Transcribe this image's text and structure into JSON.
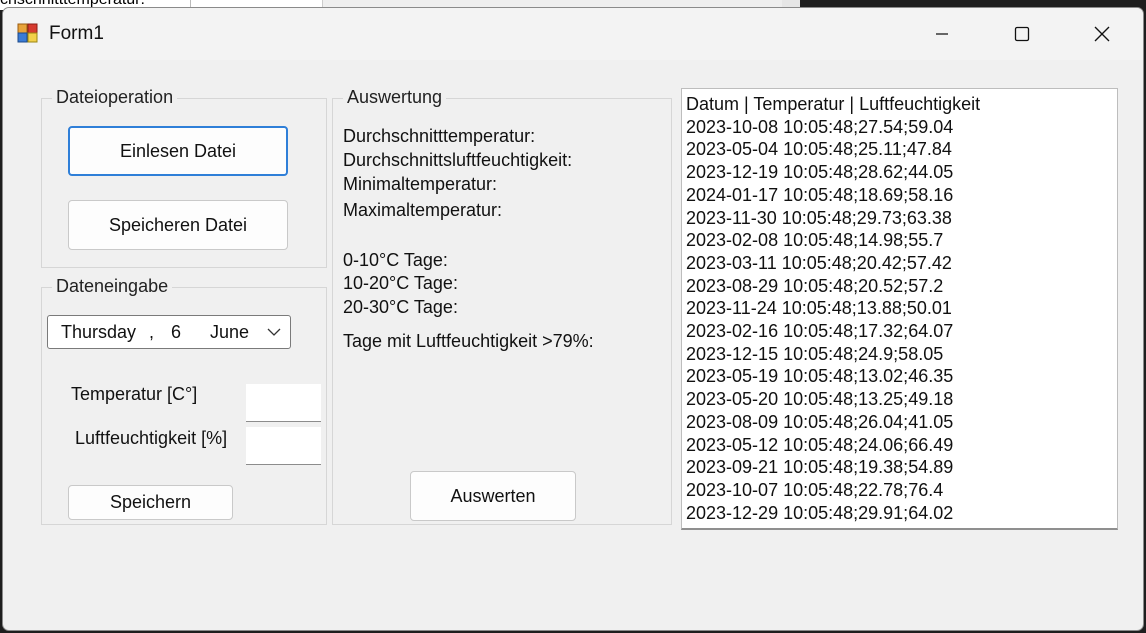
{
  "background_app": {
    "fragment_text": "chschnitttemperatur:"
  },
  "window": {
    "title": "Form1",
    "icon": "winforms-app-icon"
  },
  "titlebar_buttons": {
    "minimize": "minimize-icon",
    "maximize": "maximize-icon",
    "close": "close-icon"
  },
  "dateioperation": {
    "legend": "Dateioperation",
    "load_label": "Einlesen Datei",
    "save_label": "Speicheren Datei"
  },
  "dateneingabe": {
    "legend": "Dateneingabe",
    "date": {
      "weekday": "Thursday",
      "sep": ",",
      "day": "6",
      "month": "June"
    },
    "temperature_label": "Temperatur [C°]",
    "temperature_value": "",
    "humidity_label": "Luftfeuchtigkeit [%]",
    "humidity_value": "",
    "save_label": "Speichern"
  },
  "auswertung": {
    "legend": "Auswertung",
    "avg_temp_label": "Durchschnitttemperatur:",
    "avg_humidity_label": "Durchschnittsluftfeuchtigkeit:",
    "min_temp_label": "Minimaltemperatur:",
    "max_temp_label": "Maximaltemperatur:",
    "days_0_10_label": "0-10°C Tage:",
    "days_10_20_label": "10-20°C Tage:",
    "days_20_30_label": "20-30°C Tage:",
    "days_humidity_label": "Tage mit Luftfeuchtigkeit >79%:",
    "evaluate_label": "Auswerten"
  },
  "listbox": {
    "items": [
      "Datum | Temperatur | Luftfeuchtigkeit",
      "2023-10-08 10:05:48;27.54;59.04",
      "2023-05-04 10:05:48;25.11;47.84",
      "2023-12-19 10:05:48;28.62;44.05",
      "2024-01-17 10:05:48;18.69;58.16",
      "2023-11-30 10:05:48;29.73;63.38",
      "2023-02-08 10:05:48;14.98;55.7",
      "2023-03-11 10:05:48;20.42;57.42",
      "2023-08-29 10:05:48;20.52;57.2",
      "2023-11-24 10:05:48;13.88;50.01",
      "2023-02-16 10:05:48;17.32;64.07",
      "2023-12-15 10:05:48;24.9;58.05",
      "2023-05-19 10:05:48;13.02;46.35",
      "2023-05-20 10:05:48;13.25;49.18",
      "2023-08-09 10:05:48;26.04;41.05",
      "2023-05-12 10:05:48;24.06;66.49",
      "2023-09-21 10:05:48;19.38;54.89",
      "2023-10-07 10:05:48;22.78;76.4",
      "2023-12-29 10:05:48;29.91;64.02"
    ]
  }
}
